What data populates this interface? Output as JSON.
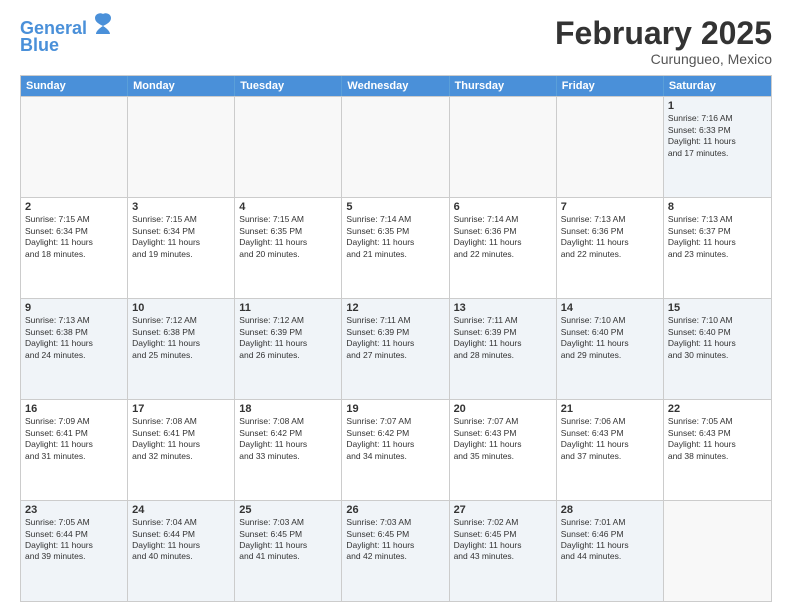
{
  "header": {
    "logo_line1": "General",
    "logo_line2": "Blue",
    "month_year": "February 2025",
    "location": "Curungueo, Mexico"
  },
  "weekdays": [
    "Sunday",
    "Monday",
    "Tuesday",
    "Wednesday",
    "Thursday",
    "Friday",
    "Saturday"
  ],
  "rows": [
    [
      {
        "day": "",
        "lines": [],
        "empty": true
      },
      {
        "day": "",
        "lines": [],
        "empty": true
      },
      {
        "day": "",
        "lines": [],
        "empty": true
      },
      {
        "day": "",
        "lines": [],
        "empty": true
      },
      {
        "day": "",
        "lines": [],
        "empty": true
      },
      {
        "day": "",
        "lines": [],
        "empty": true
      },
      {
        "day": "1",
        "lines": [
          "Sunrise: 7:16 AM",
          "Sunset: 6:33 PM",
          "Daylight: 11 hours",
          "and 17 minutes."
        ]
      }
    ],
    [
      {
        "day": "2",
        "lines": [
          "Sunrise: 7:15 AM",
          "Sunset: 6:34 PM",
          "Daylight: 11 hours",
          "and 18 minutes."
        ]
      },
      {
        "day": "3",
        "lines": [
          "Sunrise: 7:15 AM",
          "Sunset: 6:34 PM",
          "Daylight: 11 hours",
          "and 19 minutes."
        ]
      },
      {
        "day": "4",
        "lines": [
          "Sunrise: 7:15 AM",
          "Sunset: 6:35 PM",
          "Daylight: 11 hours",
          "and 20 minutes."
        ]
      },
      {
        "day": "5",
        "lines": [
          "Sunrise: 7:14 AM",
          "Sunset: 6:35 PM",
          "Daylight: 11 hours",
          "and 21 minutes."
        ]
      },
      {
        "day": "6",
        "lines": [
          "Sunrise: 7:14 AM",
          "Sunset: 6:36 PM",
          "Daylight: 11 hours",
          "and 22 minutes."
        ]
      },
      {
        "day": "7",
        "lines": [
          "Sunrise: 7:13 AM",
          "Sunset: 6:36 PM",
          "Daylight: 11 hours",
          "and 22 minutes."
        ]
      },
      {
        "day": "8",
        "lines": [
          "Sunrise: 7:13 AM",
          "Sunset: 6:37 PM",
          "Daylight: 11 hours",
          "and 23 minutes."
        ]
      }
    ],
    [
      {
        "day": "9",
        "lines": [
          "Sunrise: 7:13 AM",
          "Sunset: 6:38 PM",
          "Daylight: 11 hours",
          "and 24 minutes."
        ]
      },
      {
        "day": "10",
        "lines": [
          "Sunrise: 7:12 AM",
          "Sunset: 6:38 PM",
          "Daylight: 11 hours",
          "and 25 minutes."
        ]
      },
      {
        "day": "11",
        "lines": [
          "Sunrise: 7:12 AM",
          "Sunset: 6:39 PM",
          "Daylight: 11 hours",
          "and 26 minutes."
        ]
      },
      {
        "day": "12",
        "lines": [
          "Sunrise: 7:11 AM",
          "Sunset: 6:39 PM",
          "Daylight: 11 hours",
          "and 27 minutes."
        ]
      },
      {
        "day": "13",
        "lines": [
          "Sunrise: 7:11 AM",
          "Sunset: 6:39 PM",
          "Daylight: 11 hours",
          "and 28 minutes."
        ]
      },
      {
        "day": "14",
        "lines": [
          "Sunrise: 7:10 AM",
          "Sunset: 6:40 PM",
          "Daylight: 11 hours",
          "and 29 minutes."
        ]
      },
      {
        "day": "15",
        "lines": [
          "Sunrise: 7:10 AM",
          "Sunset: 6:40 PM",
          "Daylight: 11 hours",
          "and 30 minutes."
        ]
      }
    ],
    [
      {
        "day": "16",
        "lines": [
          "Sunrise: 7:09 AM",
          "Sunset: 6:41 PM",
          "Daylight: 11 hours",
          "and 31 minutes."
        ]
      },
      {
        "day": "17",
        "lines": [
          "Sunrise: 7:08 AM",
          "Sunset: 6:41 PM",
          "Daylight: 11 hours",
          "and 32 minutes."
        ]
      },
      {
        "day": "18",
        "lines": [
          "Sunrise: 7:08 AM",
          "Sunset: 6:42 PM",
          "Daylight: 11 hours",
          "and 33 minutes."
        ]
      },
      {
        "day": "19",
        "lines": [
          "Sunrise: 7:07 AM",
          "Sunset: 6:42 PM",
          "Daylight: 11 hours",
          "and 34 minutes."
        ]
      },
      {
        "day": "20",
        "lines": [
          "Sunrise: 7:07 AM",
          "Sunset: 6:43 PM",
          "Daylight: 11 hours",
          "and 35 minutes."
        ]
      },
      {
        "day": "21",
        "lines": [
          "Sunrise: 7:06 AM",
          "Sunset: 6:43 PM",
          "Daylight: 11 hours",
          "and 37 minutes."
        ]
      },
      {
        "day": "22",
        "lines": [
          "Sunrise: 7:05 AM",
          "Sunset: 6:43 PM",
          "Daylight: 11 hours",
          "and 38 minutes."
        ]
      }
    ],
    [
      {
        "day": "23",
        "lines": [
          "Sunrise: 7:05 AM",
          "Sunset: 6:44 PM",
          "Daylight: 11 hours",
          "and 39 minutes."
        ]
      },
      {
        "day": "24",
        "lines": [
          "Sunrise: 7:04 AM",
          "Sunset: 6:44 PM",
          "Daylight: 11 hours",
          "and 40 minutes."
        ]
      },
      {
        "day": "25",
        "lines": [
          "Sunrise: 7:03 AM",
          "Sunset: 6:45 PM",
          "Daylight: 11 hours",
          "and 41 minutes."
        ]
      },
      {
        "day": "26",
        "lines": [
          "Sunrise: 7:03 AM",
          "Sunset: 6:45 PM",
          "Daylight: 11 hours",
          "and 42 minutes."
        ]
      },
      {
        "day": "27",
        "lines": [
          "Sunrise: 7:02 AM",
          "Sunset: 6:45 PM",
          "Daylight: 11 hours",
          "and 43 minutes."
        ]
      },
      {
        "day": "28",
        "lines": [
          "Sunrise: 7:01 AM",
          "Sunset: 6:46 PM",
          "Daylight: 11 hours",
          "and 44 minutes."
        ]
      },
      {
        "day": "",
        "lines": [],
        "empty": true
      }
    ]
  ]
}
